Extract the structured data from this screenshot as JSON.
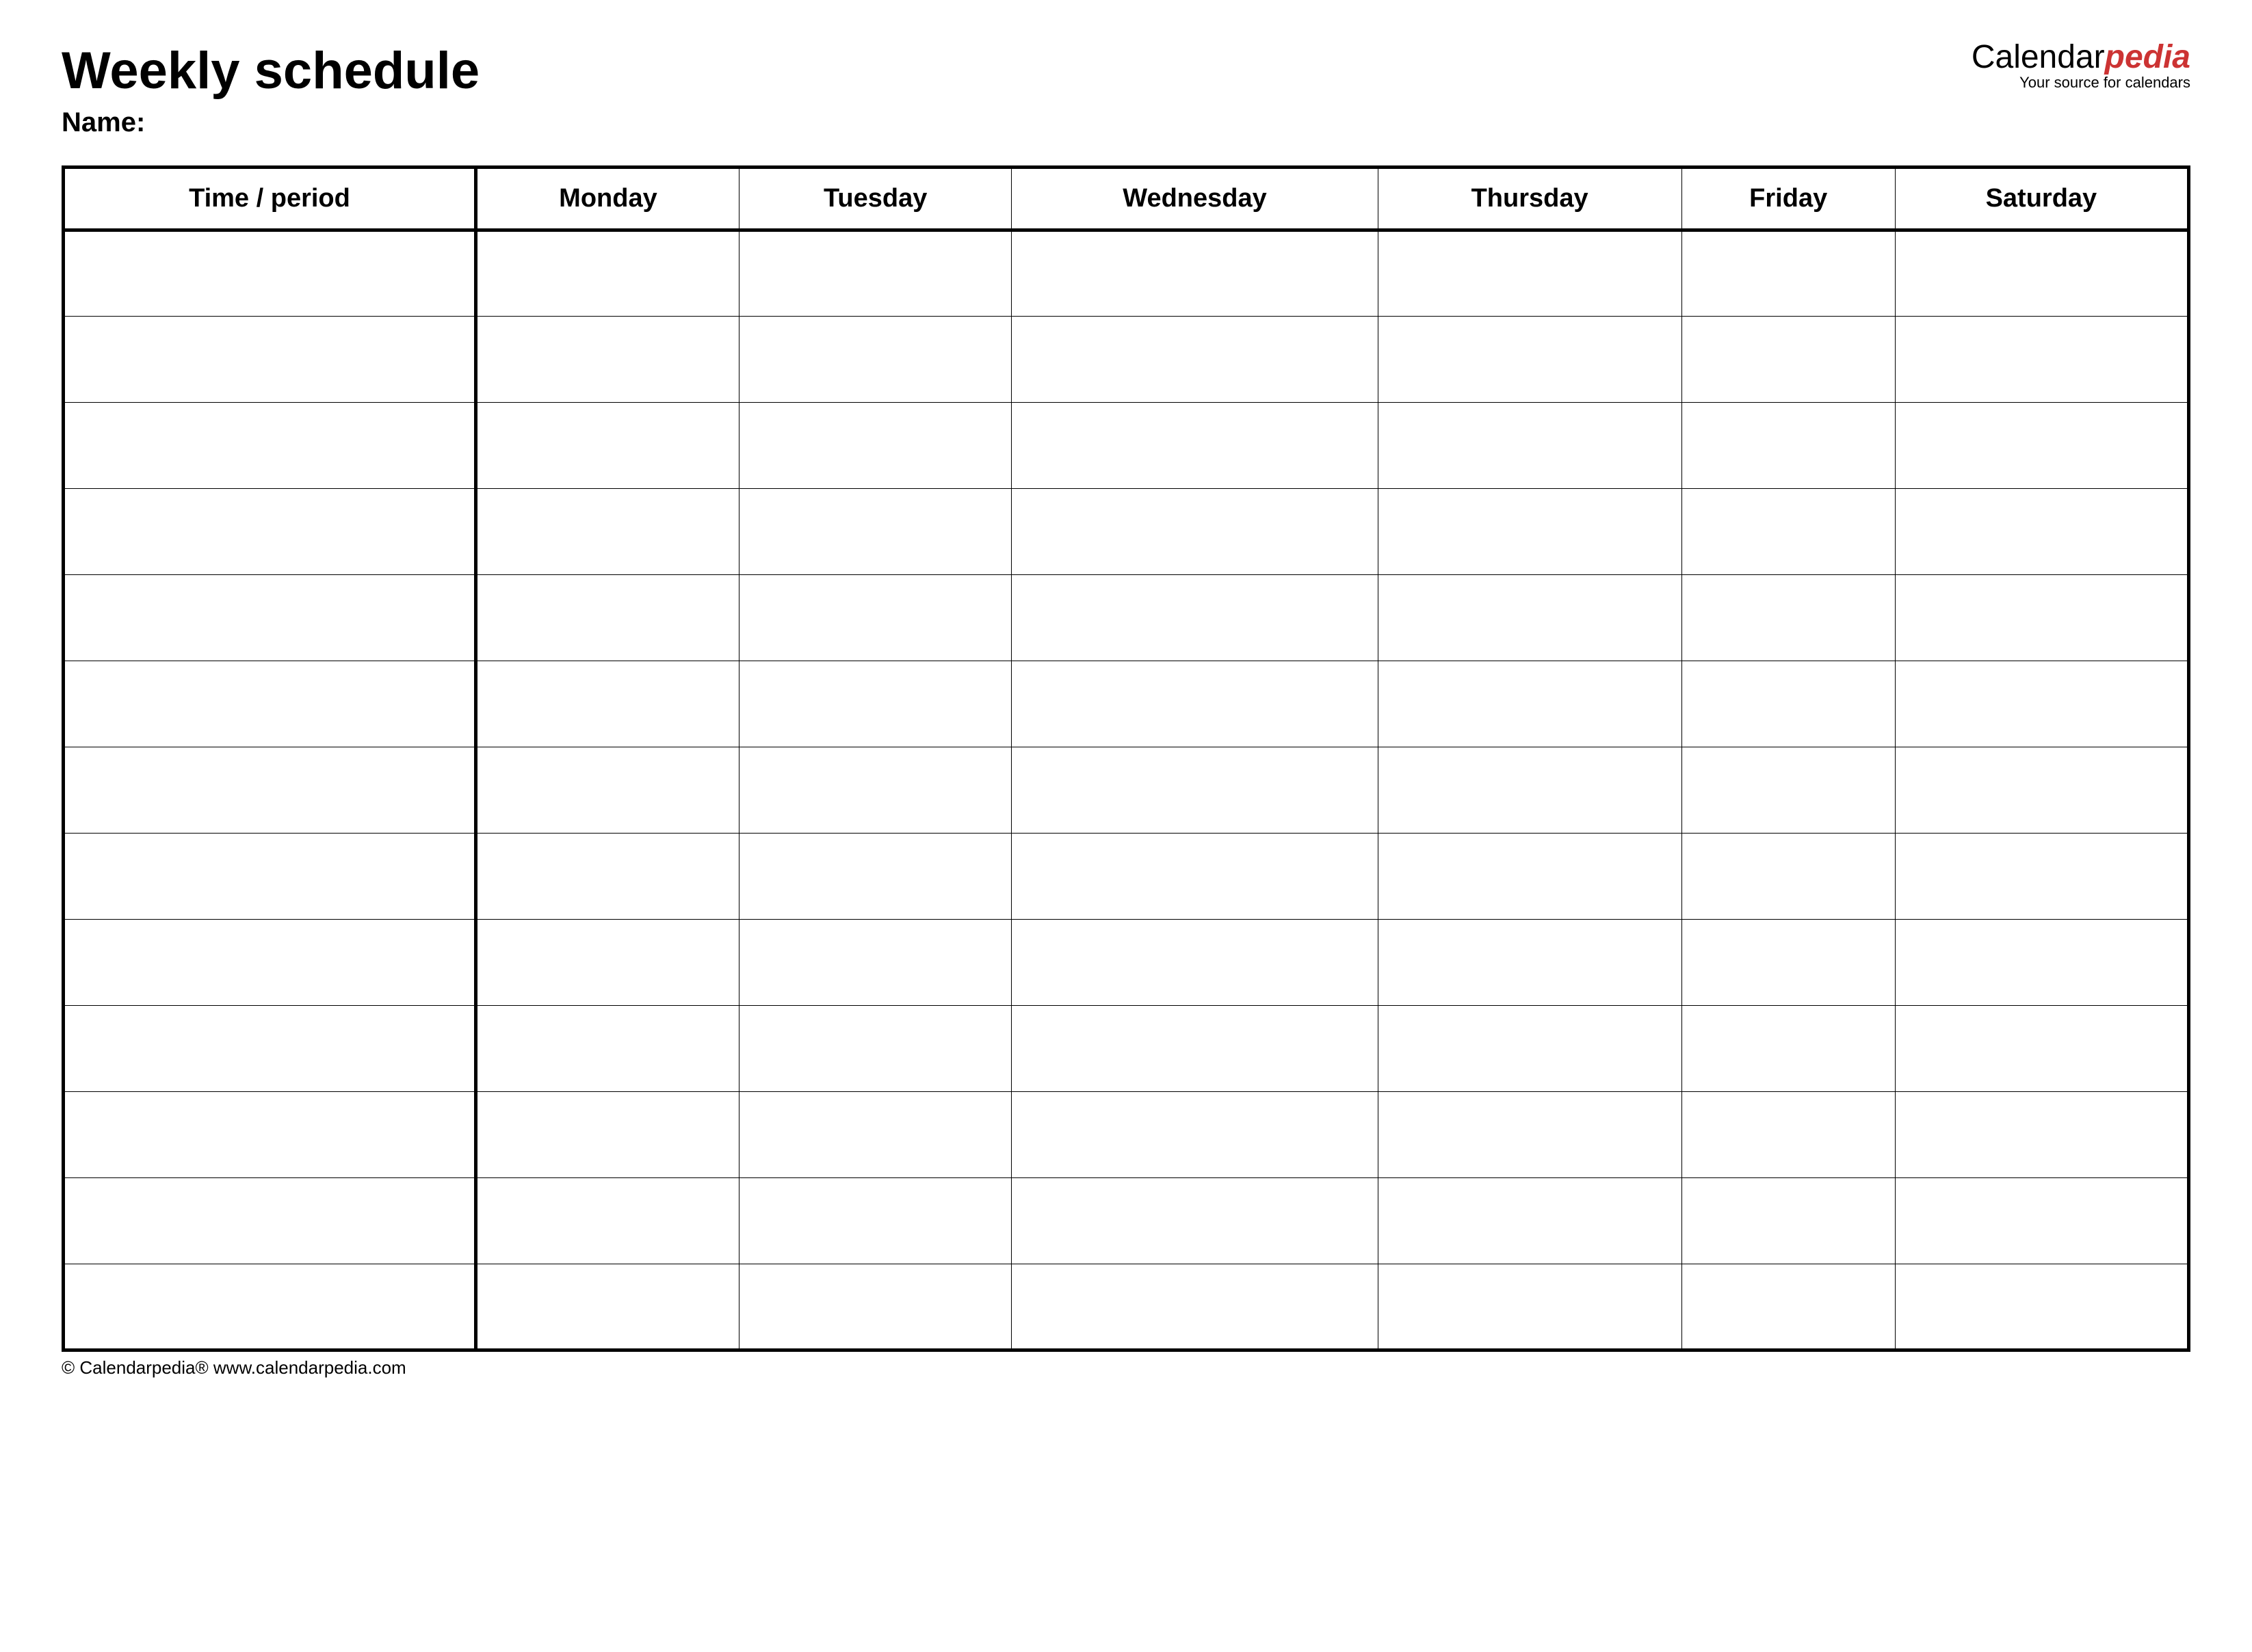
{
  "header": {
    "title": "Weekly schedule",
    "logo_black": "Calendar",
    "logo_red": "pedia",
    "logo_tagline": "Your source for calendars"
  },
  "name_label": "Name:",
  "columns": [
    "Time / period",
    "Monday",
    "Tuesday",
    "Wednesday",
    "Thursday",
    "Friday",
    "Saturday"
  ],
  "row_count": 13,
  "footer": {
    "copyright": "© Calendarpedia®   www.calendarpedia.com"
  }
}
